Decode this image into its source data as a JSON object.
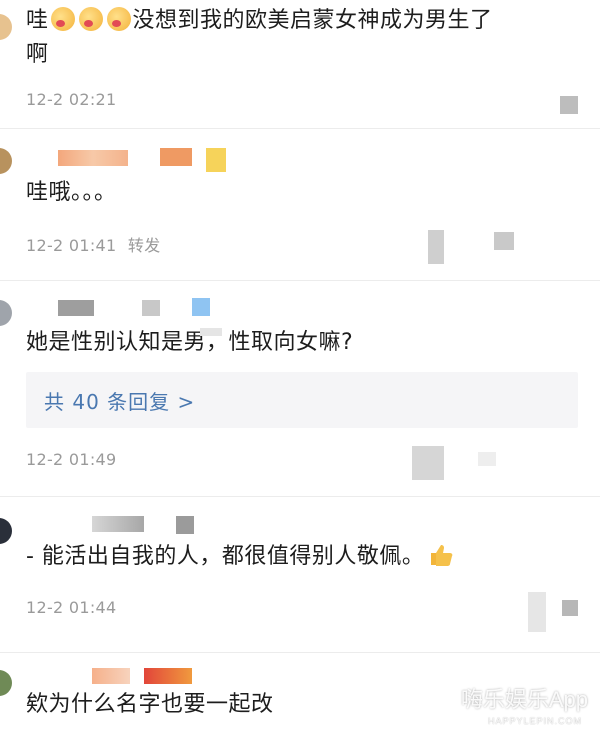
{
  "comments": [
    {
      "text_prefix": "哇",
      "emoji_count": 3,
      "text": "没想到我的欧美启蒙女神成为男生了",
      "text_line2": "啊",
      "time": "12-2 02:21",
      "action": ""
    },
    {
      "text": "哇哦。。。",
      "time": "12-2 01:41",
      "action": "转发"
    },
    {
      "text": "她是性别认知是男，性取向女嘛?",
      "reply_link": "共 40 条回复 >",
      "time": "12-2 01:49",
      "action": ""
    },
    {
      "text": "- 能活出自我的人，都很值得别人敬佩。",
      "time": "12-2 01:44",
      "action": ""
    },
    {
      "text": "欸为什么名字也要一起改"
    }
  ],
  "watermark": {
    "main": "嗨乐娱乐App",
    "sub": "HAPPYLEPIN.COM"
  },
  "colors": {
    "link": "#4a78b0",
    "meta": "#9a9a9a",
    "reply_bg": "#f5f5f7"
  }
}
